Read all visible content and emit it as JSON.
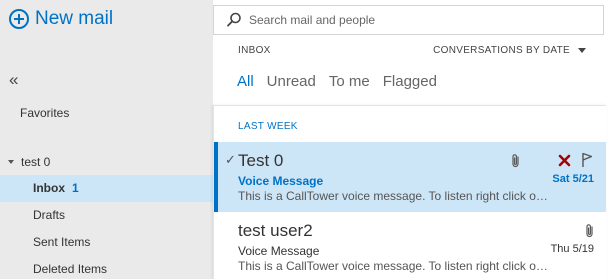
{
  "actions": {
    "new_mail_label": "New mail"
  },
  "sidebar": {
    "collapse_glyph": "«",
    "favorites_label": "Favorites",
    "account_name": "test 0",
    "folders": [
      {
        "label": "Inbox",
        "count": "1",
        "selected": true
      },
      {
        "label": "Drafts"
      },
      {
        "label": "Sent Items"
      },
      {
        "label": "Deleted Items"
      }
    ]
  },
  "search": {
    "placeholder": "Search mail and people"
  },
  "list_header": {
    "folder_label": "INBOX",
    "sort_label": "CONVERSATIONS BY DATE"
  },
  "filters": [
    {
      "label": "All",
      "active": true
    },
    {
      "label": "Unread"
    },
    {
      "label": "To me"
    },
    {
      "label": "Flagged"
    }
  ],
  "message_list": {
    "group_label": "LAST WEEK",
    "messages": [
      {
        "sender": "Test 0",
        "subject": "Voice Message",
        "preview": "This is a CallTower voice message. To listen right click o…",
        "date": "Sat 5/21",
        "selected": true,
        "checked": true,
        "check_glyph": "✓",
        "icons": [
          "paperclip-icon",
          "delete-icon",
          "flag-icon"
        ]
      },
      {
        "sender": "test user2",
        "subject": "Voice Message",
        "preview": "This is a CallTower voice message. To listen right click o…",
        "date": "Thu 5/19",
        "selected": false,
        "icons": [
          "paperclip-icon"
        ]
      }
    ]
  },
  "colors": {
    "accent": "#0072c6",
    "selected_background": "#cde6f7",
    "sidebar_background": "#eaeaea",
    "delete_icon": "#a80000"
  }
}
